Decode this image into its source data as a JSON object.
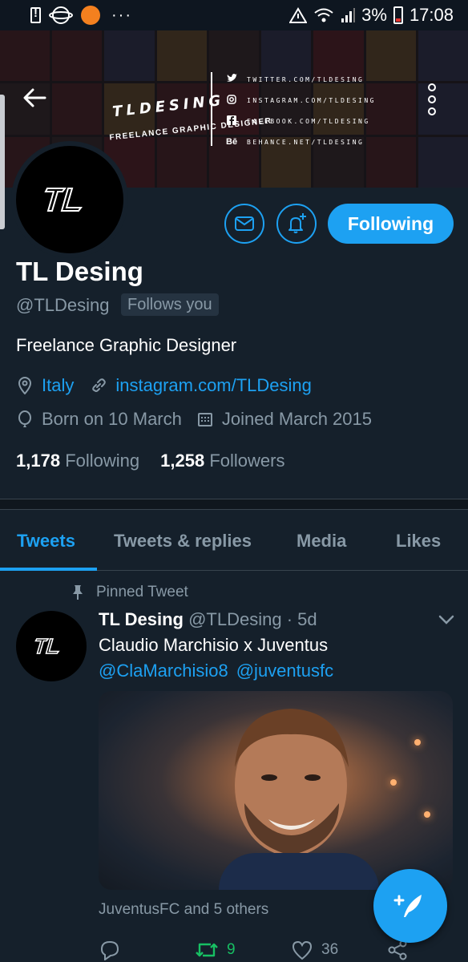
{
  "status_bar": {
    "battery": "3%",
    "time": "17:08"
  },
  "banner": {
    "title": "TLDESING",
    "subtitle": "FREELANCE GRAPHIC DESIGNER",
    "social": [
      {
        "icon": "twitter-icon",
        "text": "TWITTER.COM/TLDESING"
      },
      {
        "icon": "instagram-icon",
        "text": "INSTAGRAM.COM/TLDESING"
      },
      {
        "icon": "facebook-icon",
        "text": "FACEBOOK.COM/TLDESING"
      },
      {
        "icon": "behance-icon",
        "text": "BEHANCE.NET/TLDESING"
      }
    ]
  },
  "profile": {
    "name": "TL Desing",
    "handle": "@TLDesing",
    "follows_you": "Follows you",
    "bio": "Freelance Graphic Designer",
    "location": "Italy",
    "website": "instagram.com/TLDesing",
    "birthday": "Born on 10 March",
    "joined": "Joined March 2015",
    "following_count": "1,178",
    "following_label": "Following",
    "followers_count": "1,258",
    "followers_label": "Followers",
    "follow_button": "Following"
  },
  "tabs": [
    {
      "label": "Tweets",
      "active": true
    },
    {
      "label": "Tweets & replies",
      "active": false
    },
    {
      "label": "Media",
      "active": false
    },
    {
      "label": "Likes",
      "active": false
    }
  ],
  "tweet": {
    "pinned_label": "Pinned Tweet",
    "author": "TL Desing",
    "handle": "@TLDesing",
    "time": "· 5d",
    "text": "Claudio Marchisio x Juventus",
    "mentions": [
      "@ClaMarchisio8",
      "@juventusfc"
    ],
    "liked_by": "JuventusFC and 5 others",
    "retweets": "9",
    "likes": "36"
  },
  "colors": {
    "background": "#15202b",
    "accent": "#1da1f2",
    "muted": "#8899a6",
    "retweet": "#17bf63"
  }
}
